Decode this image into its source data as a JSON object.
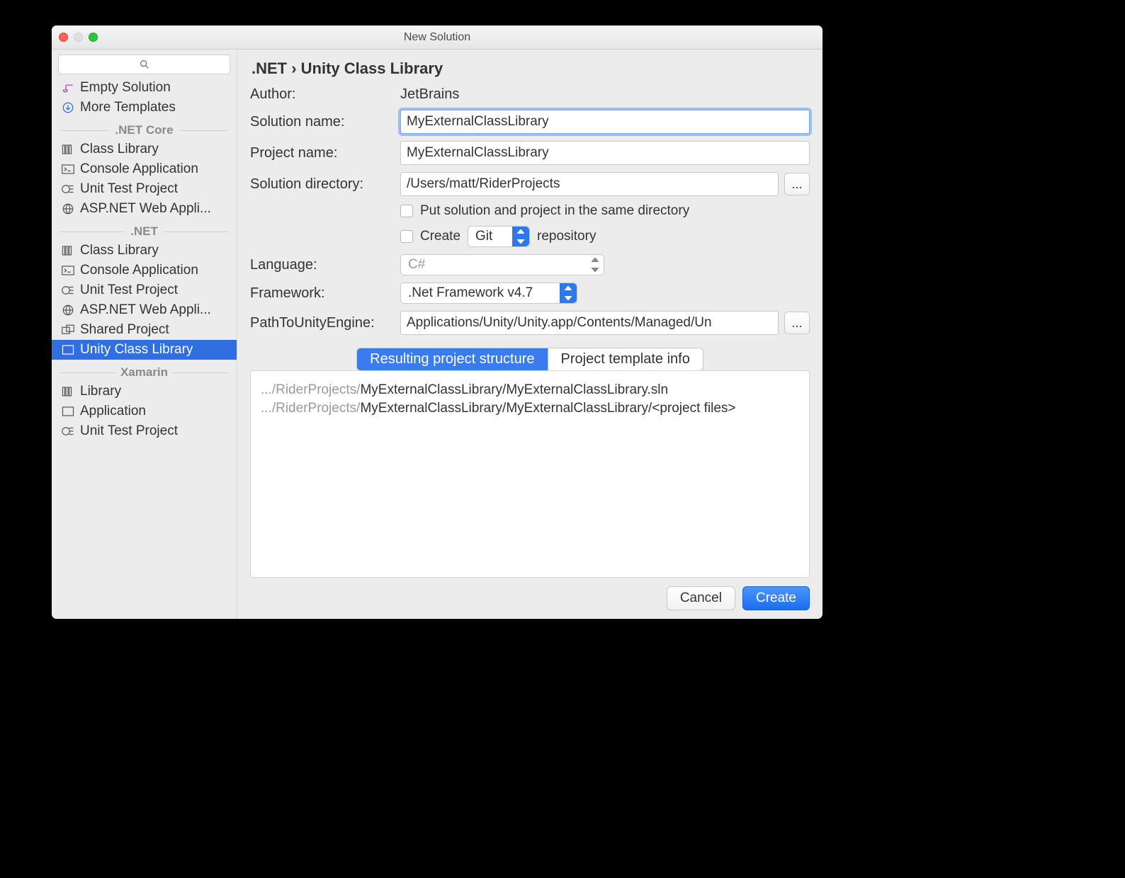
{
  "window": {
    "title": "New Solution"
  },
  "sidebar": {
    "top": [
      {
        "icon": "link-icon",
        "label": "Empty Solution"
      },
      {
        "icon": "download-icon",
        "label": "More Templates"
      }
    ],
    "groups": [
      {
        "name": ".NET Core",
        "items": [
          {
            "icon": "library-icon",
            "label": "Class Library"
          },
          {
            "icon": "console-icon",
            "label": "Console Application"
          },
          {
            "icon": "test-icon",
            "label": "Unit Test Project"
          },
          {
            "icon": "globe-icon",
            "label": "ASP.NET Web Appli..."
          }
        ]
      },
      {
        "name": ".NET",
        "items": [
          {
            "icon": "library-icon",
            "label": "Class Library"
          },
          {
            "icon": "console-icon",
            "label": "Console Application"
          },
          {
            "icon": "test-icon",
            "label": "Unit Test Project"
          },
          {
            "icon": "globe-icon",
            "label": "ASP.NET Web Appli..."
          },
          {
            "icon": "shared-icon",
            "label": "Shared Project"
          },
          {
            "icon": "unity-icon",
            "label": "Unity Class Library",
            "selected": true
          }
        ]
      },
      {
        "name": "Xamarin",
        "items": [
          {
            "icon": "library-icon",
            "label": "Library"
          },
          {
            "icon": "app-icon",
            "label": "Application"
          },
          {
            "icon": "test-icon",
            "label": "Unit Test Project"
          }
        ]
      }
    ]
  },
  "breadcrumb": ".NET › Unity Class Library",
  "form": {
    "author_label": "Author:",
    "author_value": "JetBrains",
    "solution_name_label": "Solution name:",
    "solution_name_value": "MyExternalClassLibrary",
    "project_name_label": "Project name:",
    "project_name_value": "MyExternalClassLibrary",
    "solution_dir_label": "Solution directory:",
    "solution_dir_value": "/Users/matt/RiderProjects",
    "browse_label": "...",
    "same_dir_label": "Put solution and project in the same directory",
    "create_repo_label": "Create",
    "repo_type": "Git",
    "repo_suffix": "repository",
    "language_label": "Language:",
    "language_value": "C#",
    "framework_label": "Framework:",
    "framework_value": ".Net Framework v4.7",
    "unity_path_label": "PathToUnityEngine:",
    "unity_path_value": "Applications/Unity/Unity.app/Contents/Managed/Un"
  },
  "tabs": {
    "a": "Resulting project structure",
    "b": "Project template info"
  },
  "structure": {
    "prefix1": ".../RiderProjects/",
    "line1": "MyExternalClassLibrary/MyExternalClassLibrary.sln",
    "prefix2": ".../RiderProjects/",
    "line2": "MyExternalClassLibrary/MyExternalClassLibrary/<project files>"
  },
  "footer": {
    "cancel": "Cancel",
    "create": "Create"
  }
}
